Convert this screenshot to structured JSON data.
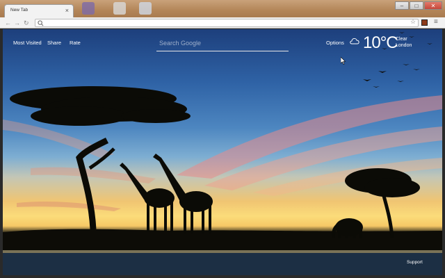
{
  "browser": {
    "tab_title": "New Tab",
    "tab_close": "×",
    "window_buttons": {
      "minimize": "–",
      "maximize": "□",
      "close": "✕"
    },
    "toolbar": {
      "back": "←",
      "forward": "→",
      "reload": "↻",
      "search_glyph": "🔍",
      "star": "☆",
      "menu": "≡"
    }
  },
  "newtab": {
    "links": {
      "most_visited": "Most Visited",
      "share": "Share",
      "rate": "Rate",
      "options": "Options"
    },
    "search": {
      "placeholder": "Search Google"
    },
    "weather": {
      "temperature": "10°C",
      "condition": "Clear",
      "city": "London",
      "icon": "cloud-icon"
    },
    "support": "Support"
  },
  "colors": {
    "toolbar_bg": "#f2f2f2",
    "sky_top": "#1d3f7c",
    "sunset": "#fbdc7a",
    "silhouette": "#0e0e08"
  }
}
